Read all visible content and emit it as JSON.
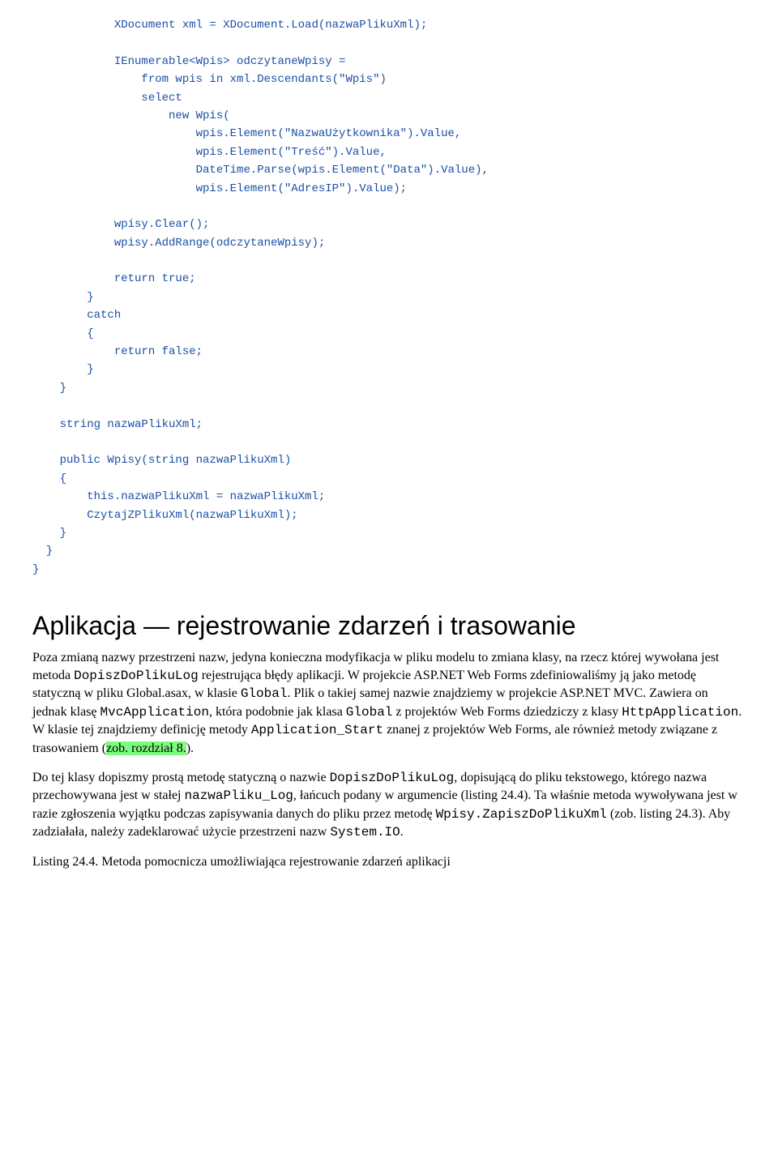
{
  "code_block": "            XDocument xml = XDocument.Load(nazwaPlikuXml);\n\n            IEnumerable<Wpis> odczytaneWpisy =\n                from wpis in xml.Descendants(\"Wpis\")\n                select\n                    new Wpis(\n                        wpis.Element(\"NazwaUżytkownika\").Value,\n                        wpis.Element(\"Treść\").Value,\n                        DateTime.Parse(wpis.Element(\"Data\").Value),\n                        wpis.Element(\"AdresIP\").Value);\n\n            wpisy.Clear();\n            wpisy.AddRange(odczytaneWpisy);\n\n            return true;\n        }\n        catch\n        {\n            return false;\n        }\n    }\n\n    string nazwaPlikuXml;\n\n    public Wpisy(string nazwaPlikuXml)\n    {\n        this.nazwaPlikuXml = nazwaPlikuXml;\n        CzytajZPlikuXml(nazwaPlikuXml);\n    }\n  }\n}",
  "heading": "Aplikacja — rejestrowanie zdarzeń i trasowanie",
  "para1": {
    "t1": "Poza zmianą nazwy przestrzeni nazw, jedyna konieczna modyfikacja w pliku modelu to zmiana klasy, na rzecz której wywołana jest metoda ",
    "c1": "DopiszDoPlikuLog",
    "t2": " rejestrująca błędy aplikacji. W projekcie ASP.NET Web Forms zdefiniowaliśmy ją jako metodę statyczną w pliku Global.asax, w klasie ",
    "c2": "Global",
    "t3": ". Plik o takiej samej nazwie znajdziemy w projekcie ASP.NET MVC. Zawiera on jednak klasę ",
    "c3": "MvcApplication",
    "t4": ", która podobnie jak klasa ",
    "c4": "Global",
    "t5": " z projektów Web Forms dziedziczy z klasy ",
    "c5": "HttpApplication",
    "t6": ". W klasie tej znajdziemy definicję metody ",
    "c6": "Application_Start",
    "t7": " znanej z projektów Web Forms, ale również metody związane z trasowaniem (",
    "hl": "zob. rozdział 8.",
    "t8": ")."
  },
  "para2": {
    "t1": "Do tej klasy dopiszmy prostą metodę statyczną o nazwie ",
    "c1": "DopiszDoPlikuLog",
    "t2": ", dopisującą do pliku tekstowego, którego nazwa przechowywana jest w stałej ",
    "c2": "nazwaPliku_Log",
    "t3": ", łańcuch podany w argumencie (listing 24.4). Ta właśnie metoda wywoływana jest w razie zgłoszenia wyjątku podczas zapisywania danych do pliku przez metodę ",
    "c3": "Wpisy.ZapiszDoPlikuXml",
    "t4": " (zob. listing 24.3). Aby zadziałała, należy zadeklarować użycie przestrzeni nazw ",
    "c4": "System.IO",
    "t5": "."
  },
  "para3": "Listing 24.4. Metoda pomocnicza umożliwiająca rejestrowanie zdarzeń aplikacji"
}
